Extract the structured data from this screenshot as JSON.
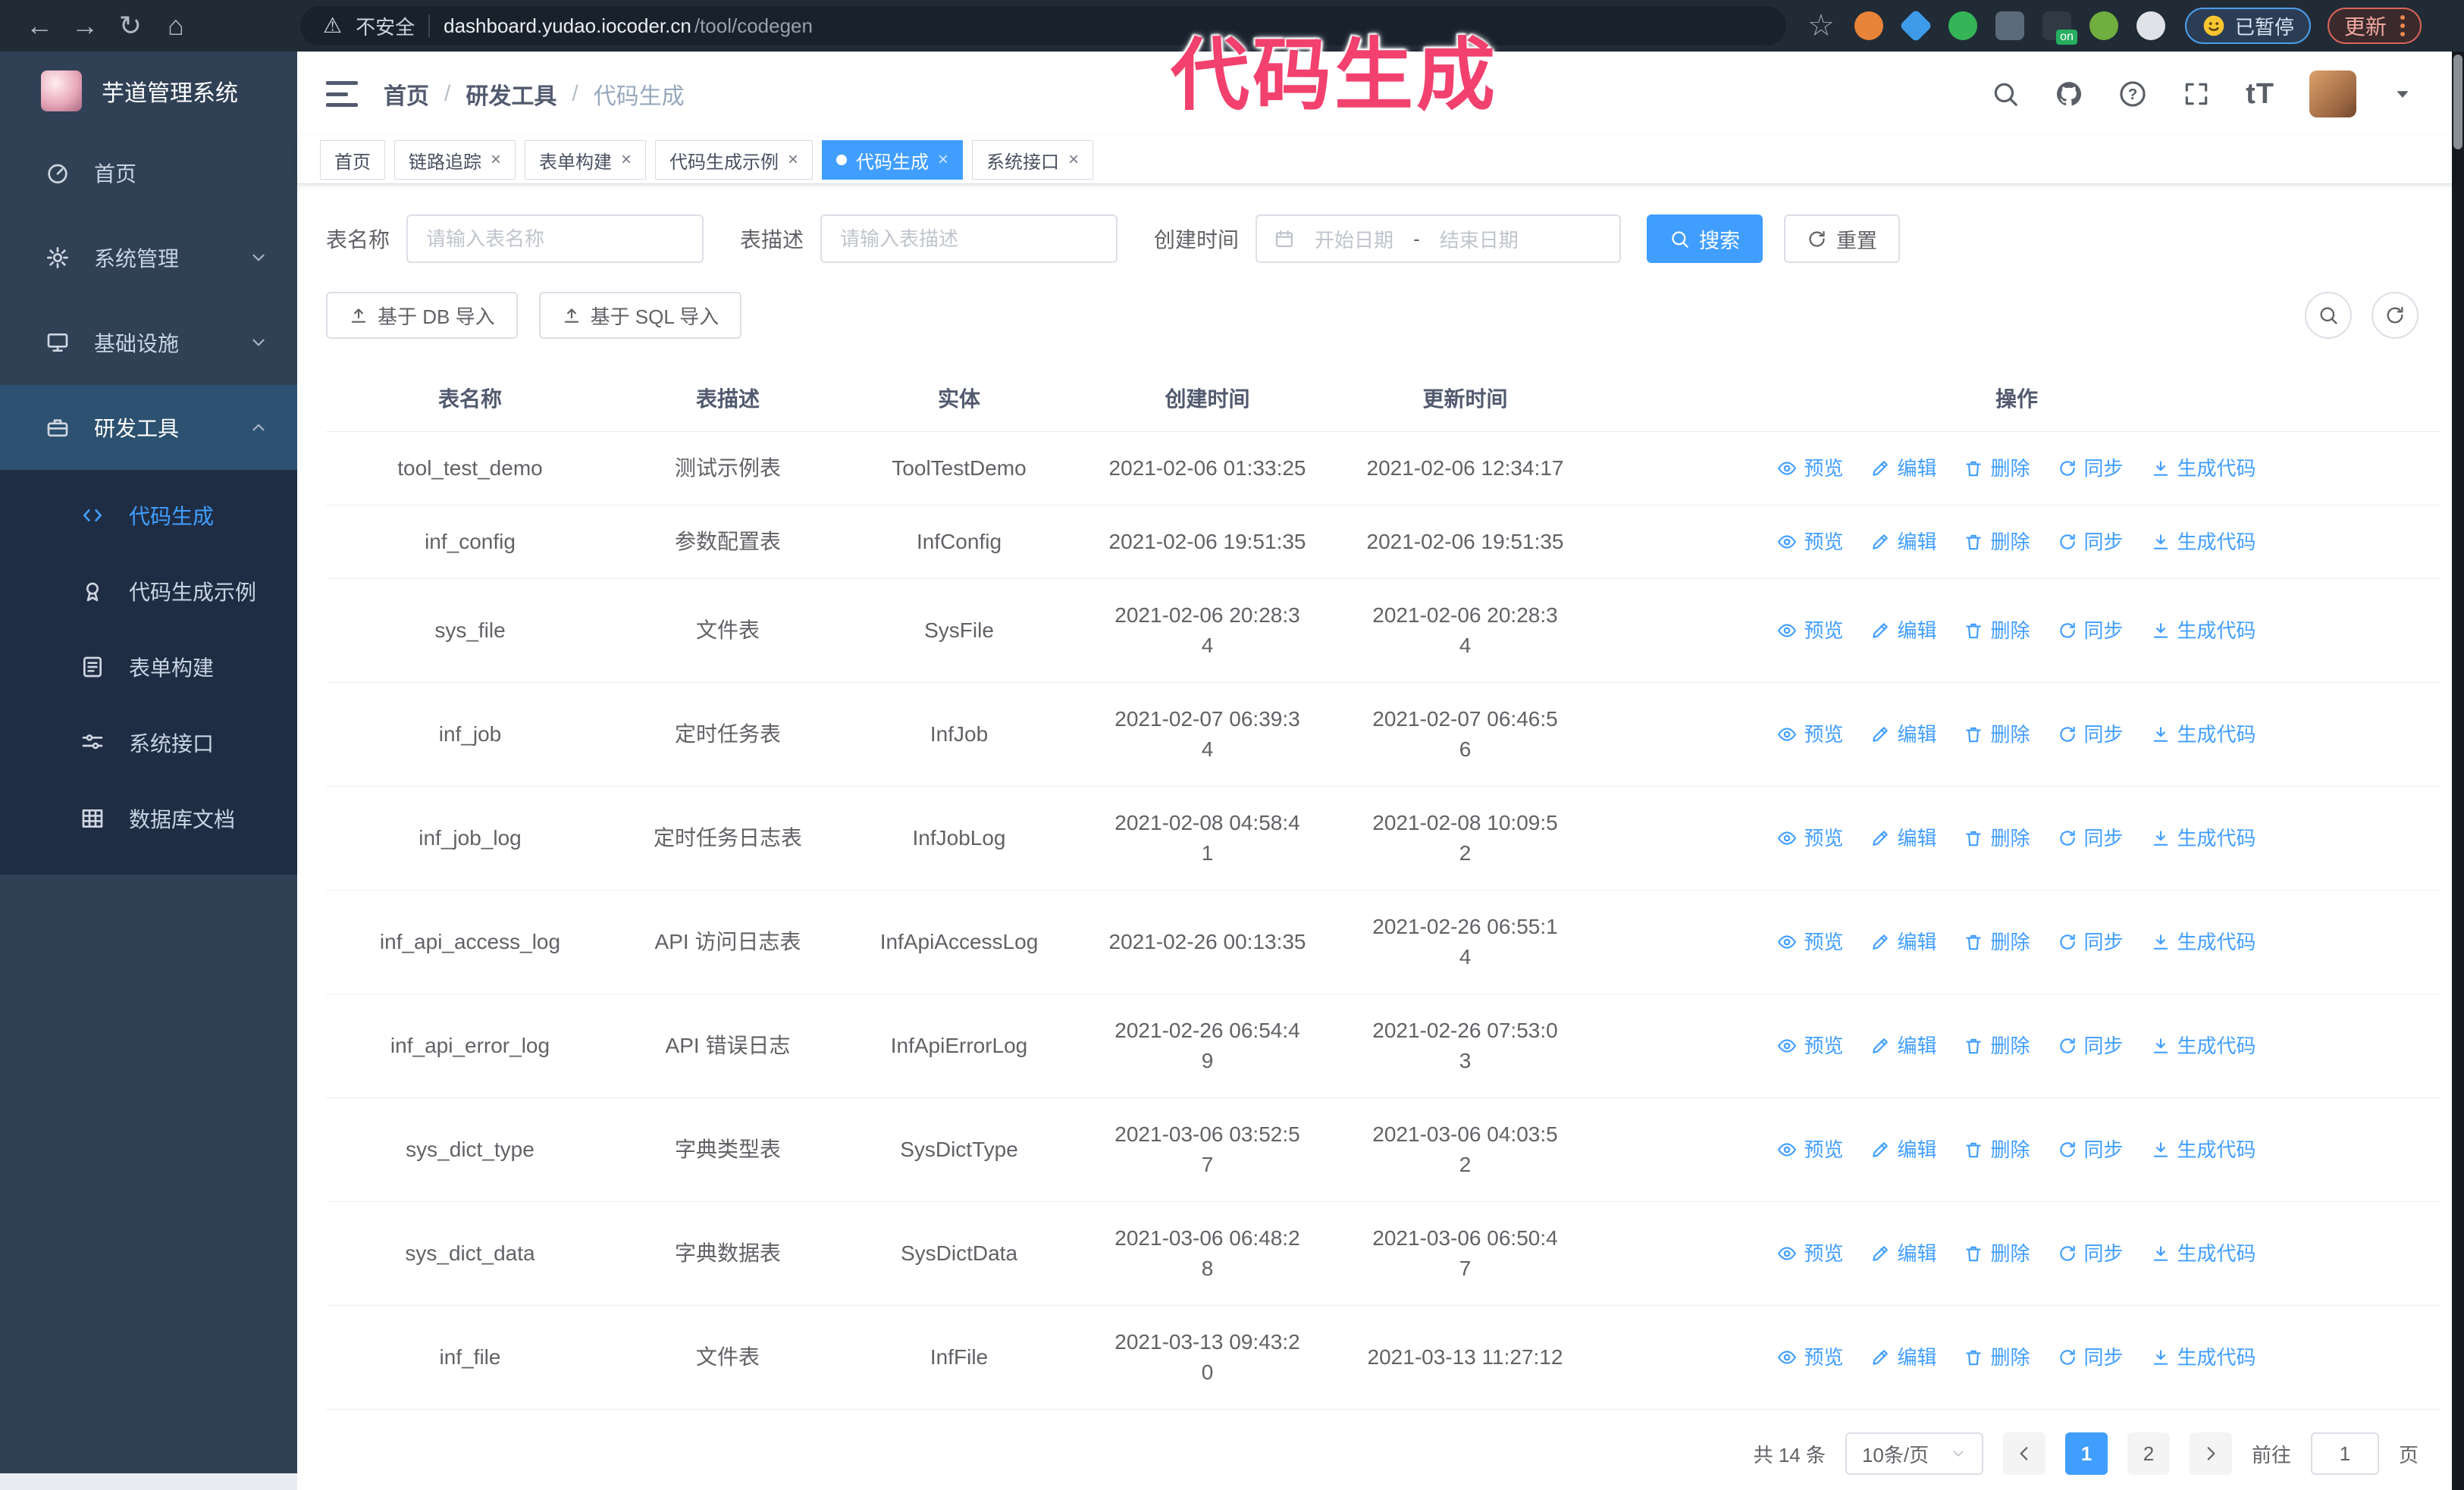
{
  "annotation": {
    "text": "代码生成",
    "color": "#f2416e"
  },
  "browser": {
    "nav_icons": [
      "back-icon",
      "forward-icon",
      "reload-icon",
      "home-icon"
    ],
    "security_label": "不安全",
    "url_host": "dashboard.yudao.iocoder.cn",
    "url_path": "/tool/codegen",
    "extensions": [
      {
        "name": "orange-extension",
        "shape": "circle",
        "color": "#e8833a"
      },
      {
        "name": "blue-gem-extension",
        "shape": "diamond",
        "color": "#3d9be9"
      },
      {
        "name": "green-check-extension",
        "shape": "circle",
        "color": "#35b558"
      },
      {
        "name": "grid-drop-extension",
        "shape": "square",
        "color": "#5b6a78"
      },
      {
        "name": "dark-on-extension",
        "shape": "square",
        "color": "#2f3a44",
        "badge": "on"
      },
      {
        "name": "green-frog-extension",
        "shape": "circle",
        "color": "#6fae3f"
      },
      {
        "name": "puzzle-extension",
        "shape": "circle",
        "color": "#dfe3e8"
      }
    ],
    "paused_badge": "已暂停",
    "update_button": "更新"
  },
  "sidebar": {
    "app_title": "芋道管理系统",
    "items": [
      {
        "label": "首页",
        "icon": "dashboard-icon",
        "chevron": "",
        "active": false
      },
      {
        "label": "系统管理",
        "icon": "gear-icon",
        "chevron": "down",
        "active": false
      },
      {
        "label": "基础设施",
        "icon": "monitor-icon",
        "chevron": "down",
        "active": false
      },
      {
        "label": "研发工具",
        "icon": "toolbox-icon",
        "chevron": "up",
        "active": true
      }
    ],
    "submenu": [
      {
        "label": "代码生成",
        "icon": "code-icon",
        "active": true
      },
      {
        "label": "代码生成示例",
        "icon": "medal-icon",
        "active": false
      },
      {
        "label": "表单构建",
        "icon": "form-icon",
        "active": false
      },
      {
        "label": "系统接口",
        "icon": "sliders-icon",
        "active": false
      },
      {
        "label": "数据库文档",
        "icon": "database-grid-icon",
        "active": false
      }
    ]
  },
  "header": {
    "breadcrumb": [
      "首页",
      "研发工具",
      "代码生成"
    ]
  },
  "tabs": [
    {
      "label": "首页",
      "closable": false,
      "active": false
    },
    {
      "label": "链路追踪",
      "closable": true,
      "active": false
    },
    {
      "label": "表单构建",
      "closable": true,
      "active": false
    },
    {
      "label": "代码生成示例",
      "closable": true,
      "active": false
    },
    {
      "label": "代码生成",
      "closable": true,
      "active": true
    },
    {
      "label": "系统接口",
      "closable": true,
      "active": false
    }
  ],
  "filters": {
    "table_name_label": "表名称",
    "table_name_placeholder": "请输入表名称",
    "table_desc_label": "表描述",
    "table_desc_placeholder": "请输入表描述",
    "create_time_label": "创建时间",
    "date_start_placeholder": "开始日期",
    "date_separator": "-",
    "date_end_placeholder": "结束日期",
    "search_button": "搜索",
    "reset_button": "重置"
  },
  "toolbar": {
    "import_db_button": "基于 DB 导入",
    "import_sql_button": "基于 SQL 导入"
  },
  "table": {
    "columns": [
      "表名称",
      "表描述",
      "实体",
      "创建时间",
      "更新时间",
      "操作"
    ],
    "actions": [
      {
        "label": "预览",
        "icon": "eye-icon"
      },
      {
        "label": "编辑",
        "icon": "edit-icon"
      },
      {
        "label": "删除",
        "icon": "delete-icon"
      },
      {
        "label": "同步",
        "icon": "sync-icon"
      },
      {
        "label": "生成代码",
        "icon": "download-icon"
      }
    ],
    "rows": [
      {
        "name": "tool_test_demo",
        "desc": "测试示例表",
        "entity": "ToolTestDemo",
        "created": "2021-02-06 01:33:25",
        "updated": "2021-02-06 12:34:17"
      },
      {
        "name": "inf_config",
        "desc": "参数配置表",
        "entity": "InfConfig",
        "created": "2021-02-06 19:51:35",
        "updated": "2021-02-06 19:51:35"
      },
      {
        "name": "sys_file",
        "desc": "文件表",
        "entity": "SysFile",
        "created": "2021-02-06 20:28:3\n4",
        "updated": "2021-02-06 20:28:3\n4"
      },
      {
        "name": "inf_job",
        "desc": "定时任务表",
        "entity": "InfJob",
        "created": "2021-02-07 06:39:3\n4",
        "updated": "2021-02-07 06:46:5\n6"
      },
      {
        "name": "inf_job_log",
        "desc": "定时任务日志表",
        "entity": "InfJobLog",
        "created": "2021-02-08 04:58:4\n1",
        "updated": "2021-02-08 10:09:5\n2"
      },
      {
        "name": "inf_api_access_log",
        "desc": "API 访问日志表",
        "entity": "InfApiAccessLog",
        "created": "2021-02-26 00:13:35",
        "updated": "2021-02-26 06:55:1\n4"
      },
      {
        "name": "inf_api_error_log",
        "desc": "API 错误日志",
        "entity": "InfApiErrorLog",
        "created": "2021-02-26 06:54:4\n9",
        "updated": "2021-02-26 07:53:0\n3"
      },
      {
        "name": "sys_dict_type",
        "desc": "字典类型表",
        "entity": "SysDictType",
        "created": "2021-03-06 03:52:5\n7",
        "updated": "2021-03-06 04:03:5\n2"
      },
      {
        "name": "sys_dict_data",
        "desc": "字典数据表",
        "entity": "SysDictData",
        "created": "2021-03-06 06:48:2\n8",
        "updated": "2021-03-06 06:50:4\n7"
      },
      {
        "name": "inf_file",
        "desc": "文件表",
        "entity": "InfFile",
        "created": "2021-03-13 09:43:2\n0",
        "updated": "2021-03-13 11:27:12"
      }
    ]
  },
  "pagination": {
    "total": "共 14 条",
    "page_size": "10条/页",
    "pages": [
      "1",
      "2"
    ],
    "active_page": "1",
    "goto_label": "前往",
    "goto_value": "1",
    "page_label": "页"
  },
  "colors": {
    "accent": "#409EFF",
    "annotation": "#f2416e",
    "sidebar": "#304156",
    "submenu": "#1f2d44"
  }
}
